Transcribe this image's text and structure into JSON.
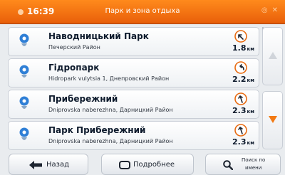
{
  "header": {
    "time": "16:39",
    "title": "Парк и зона отдыха",
    "status_icons": [
      "gps-icon",
      "battery-icon"
    ],
    "bg_color": "#f27a14"
  },
  "results": [
    {
      "name": "Наводницький Парк",
      "address": "Печерский Район",
      "distance": "1.8",
      "unit": "км",
      "direction_icon": "turn-left-icon"
    },
    {
      "name": "Гідропарк",
      "address": "Hidropark vulytsia 1, Днепровский Район",
      "distance": "2.2",
      "unit": "км",
      "direction_icon": "turn-left-icon"
    },
    {
      "name": "Прибережний",
      "address": "Dniprovska naberezhna, Дарницкий Район",
      "distance": "2.3",
      "unit": "км",
      "direction_icon": "turn-left-icon"
    },
    {
      "name": "Парк Прибережний",
      "address": "Dniprovska naberezhna, Дарницкий Район",
      "distance": "2.3",
      "unit": "км",
      "direction_icon": "turn-left-icon"
    }
  ],
  "footer": {
    "back_label": "Назад",
    "details_label": "Подробнее",
    "search_label_line1": "Поиск по",
    "search_label_line2": "имени"
  },
  "colors": {
    "accent": "#f27a14",
    "pin": "#2f7fd6",
    "arrow_up_disabled": "#d0d4da",
    "arrow_down": "#f27a14"
  }
}
